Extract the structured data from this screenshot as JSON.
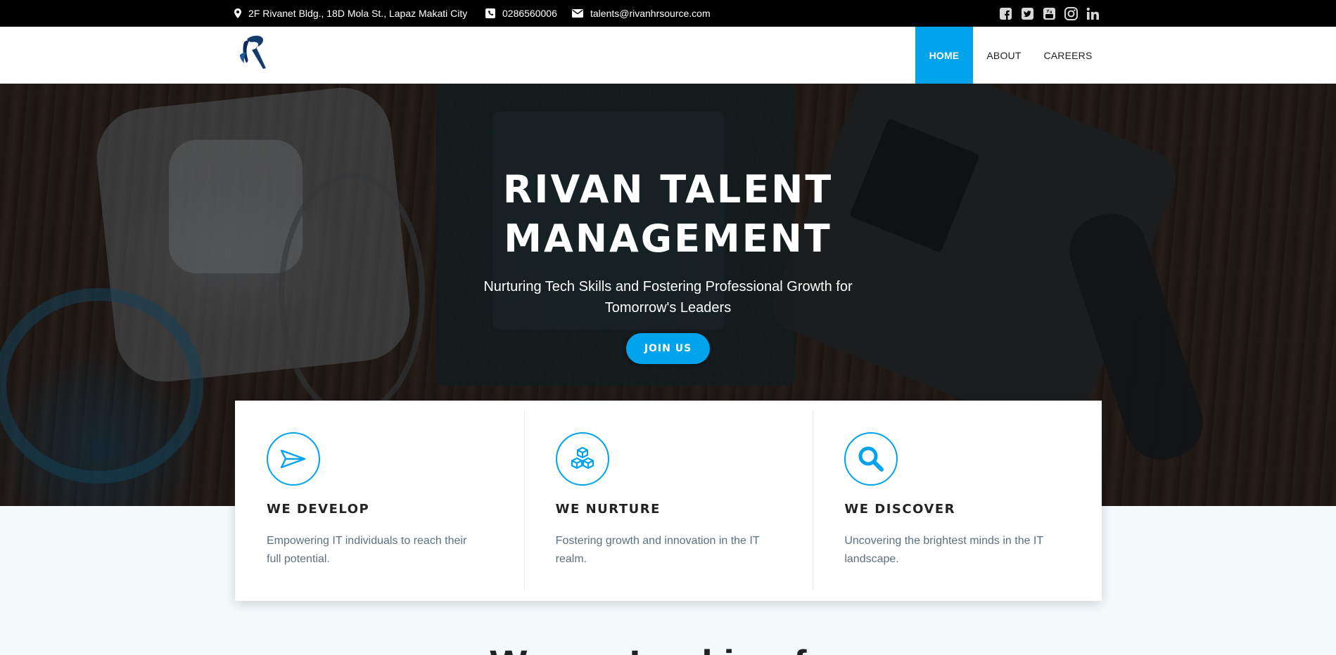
{
  "topbar": {
    "address": "2F Rivanet Bldg., 18D Mola St., Lapaz Makati City",
    "phone": "0286560006",
    "email": "talents@rivanhrsource.com",
    "social_icons": [
      "facebook-icon",
      "twitter-icon",
      "youtube-icon",
      "instagram-icon",
      "linkedin-icon"
    ]
  },
  "nav": {
    "items": [
      {
        "label": "HOME",
        "active": true
      },
      {
        "label": "ABOUT",
        "active": false
      },
      {
        "label": "CAREERS",
        "active": false
      }
    ]
  },
  "hero": {
    "title_line1": "RIVAN TALENT",
    "title_line2": "MANAGEMENT",
    "subtitle_line1": "Nurturing Tech Skills and Fostering Professional Growth for",
    "subtitle_line2": "Tomorrow's Leaders",
    "cta_label": "JOIN US"
  },
  "features": [
    {
      "icon": "paper-plane-icon",
      "title": "WE DEVELOP",
      "desc_line1": "Empowering IT individuals to reach their",
      "desc_line2": "full potential."
    },
    {
      "icon": "cubes-icon",
      "title": "WE NURTURE",
      "desc_line1": "Fostering growth and innovation in the IT",
      "desc_line2": "realm."
    },
    {
      "icon": "search-icon",
      "title": "WE DISCOVER",
      "desc_line1": "Uncovering the brightest minds in the IT",
      "desc_line2": "landscape."
    }
  ],
  "section": {
    "heading": "We are Looking for"
  },
  "colors": {
    "accent": "#00a3ec",
    "topbar_bg": "#000000",
    "text_muted": "#5d7080"
  }
}
